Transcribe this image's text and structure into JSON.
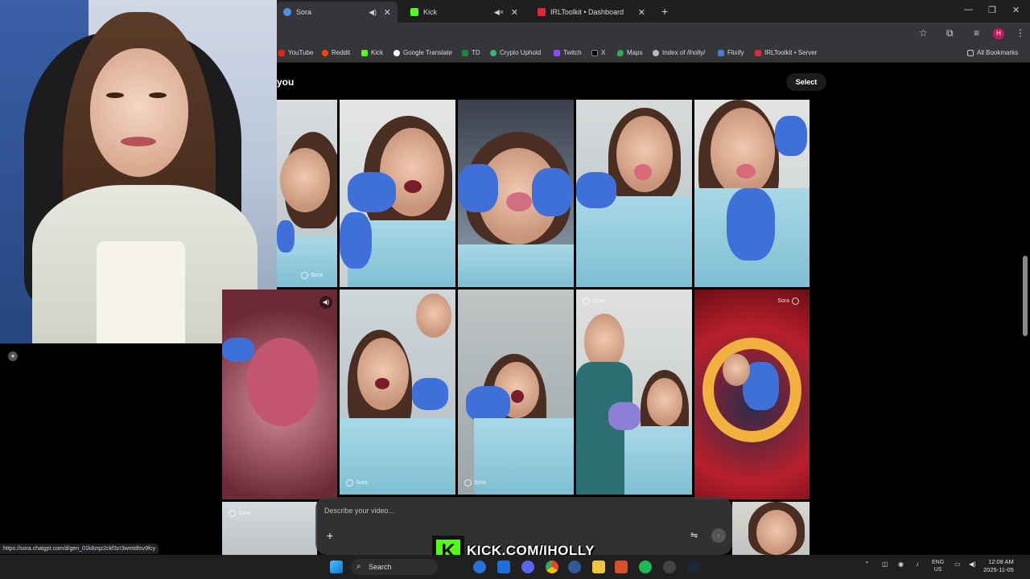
{
  "browser": {
    "tabs": [
      {
        "label": "Sora",
        "active": true
      },
      {
        "label": "Kick",
        "active": false
      },
      {
        "label": "IRLToolkit • Dashboard",
        "active": false
      }
    ],
    "bookmarks": [
      "YouTube",
      "Reddit",
      "Kick",
      "Google Translate",
      "TD",
      "Crypto Uphold",
      "Twitch",
      "X",
      "Maps",
      "Index of /iholly/",
      "Flixify",
      "IRLToolkit • Server"
    ],
    "all_bookmarks_label": "All Bookmarks",
    "profile_initial": "H",
    "status_url": "https://sora.chatgpt.com/d/gen_01k8zqz2ckf3zr3wmtdtsv9fcy"
  },
  "page": {
    "section_title": "you",
    "select_label": "Select",
    "tile_watermark": "Sora",
    "composer_placeholder": "Describe your video..."
  },
  "overlay": {
    "kick_letter": "K",
    "kick_text": "KICK.COM/IHOLLY"
  },
  "taskbar": {
    "search_label": "Search",
    "lang_line1": "ENG",
    "lang_line2": "US",
    "time": "12:08 AM",
    "date": "2025-11-05"
  },
  "colors": {
    "kick_green": "#53fc18",
    "glove_blue": "#3f6fd8",
    "bib_blue": "#a8d8e6"
  }
}
